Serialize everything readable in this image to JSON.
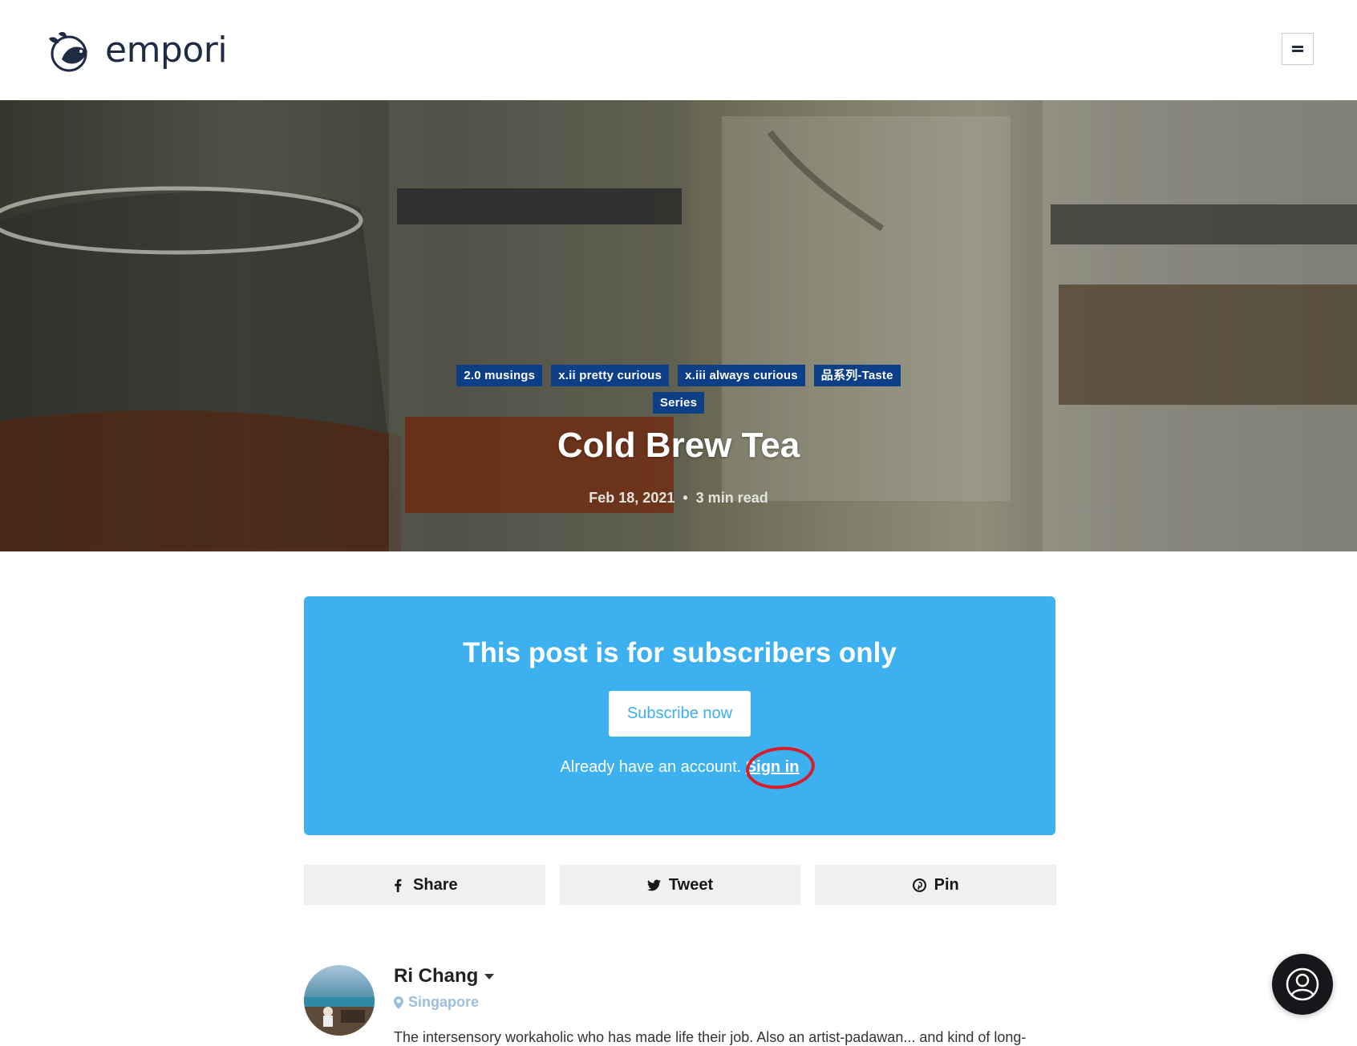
{
  "header": {
    "logo_text": "empori",
    "menu_icon": "hamburger-icon"
  },
  "hero": {
    "tags": [
      "2.0 musings",
      "x.ii pretty curious",
      "x.iii always curious",
      "品系列-Taste",
      "Series"
    ],
    "title": "Cold Brew Tea",
    "date": "Feb 18, 2021",
    "separator": "•",
    "read_time": "3 min read"
  },
  "cta": {
    "title": "This post is for subscribers only",
    "button_label": "Subscribe now",
    "signin_prompt": "Already have an account.",
    "signin_link": "Sign in",
    "background_color": "#3db0ef"
  },
  "share": {
    "facebook_label": "Share",
    "twitter_label": "Tweet",
    "pinterest_label": "Pin"
  },
  "author": {
    "name": "Ri Chang",
    "location": "Singapore",
    "bio": "The intersensory workaholic who has made life their job. Also an artist-padawan... and kind of long-"
  },
  "colors": {
    "tag_bg": "#0d3f86",
    "annotation": "#d91c2b"
  }
}
